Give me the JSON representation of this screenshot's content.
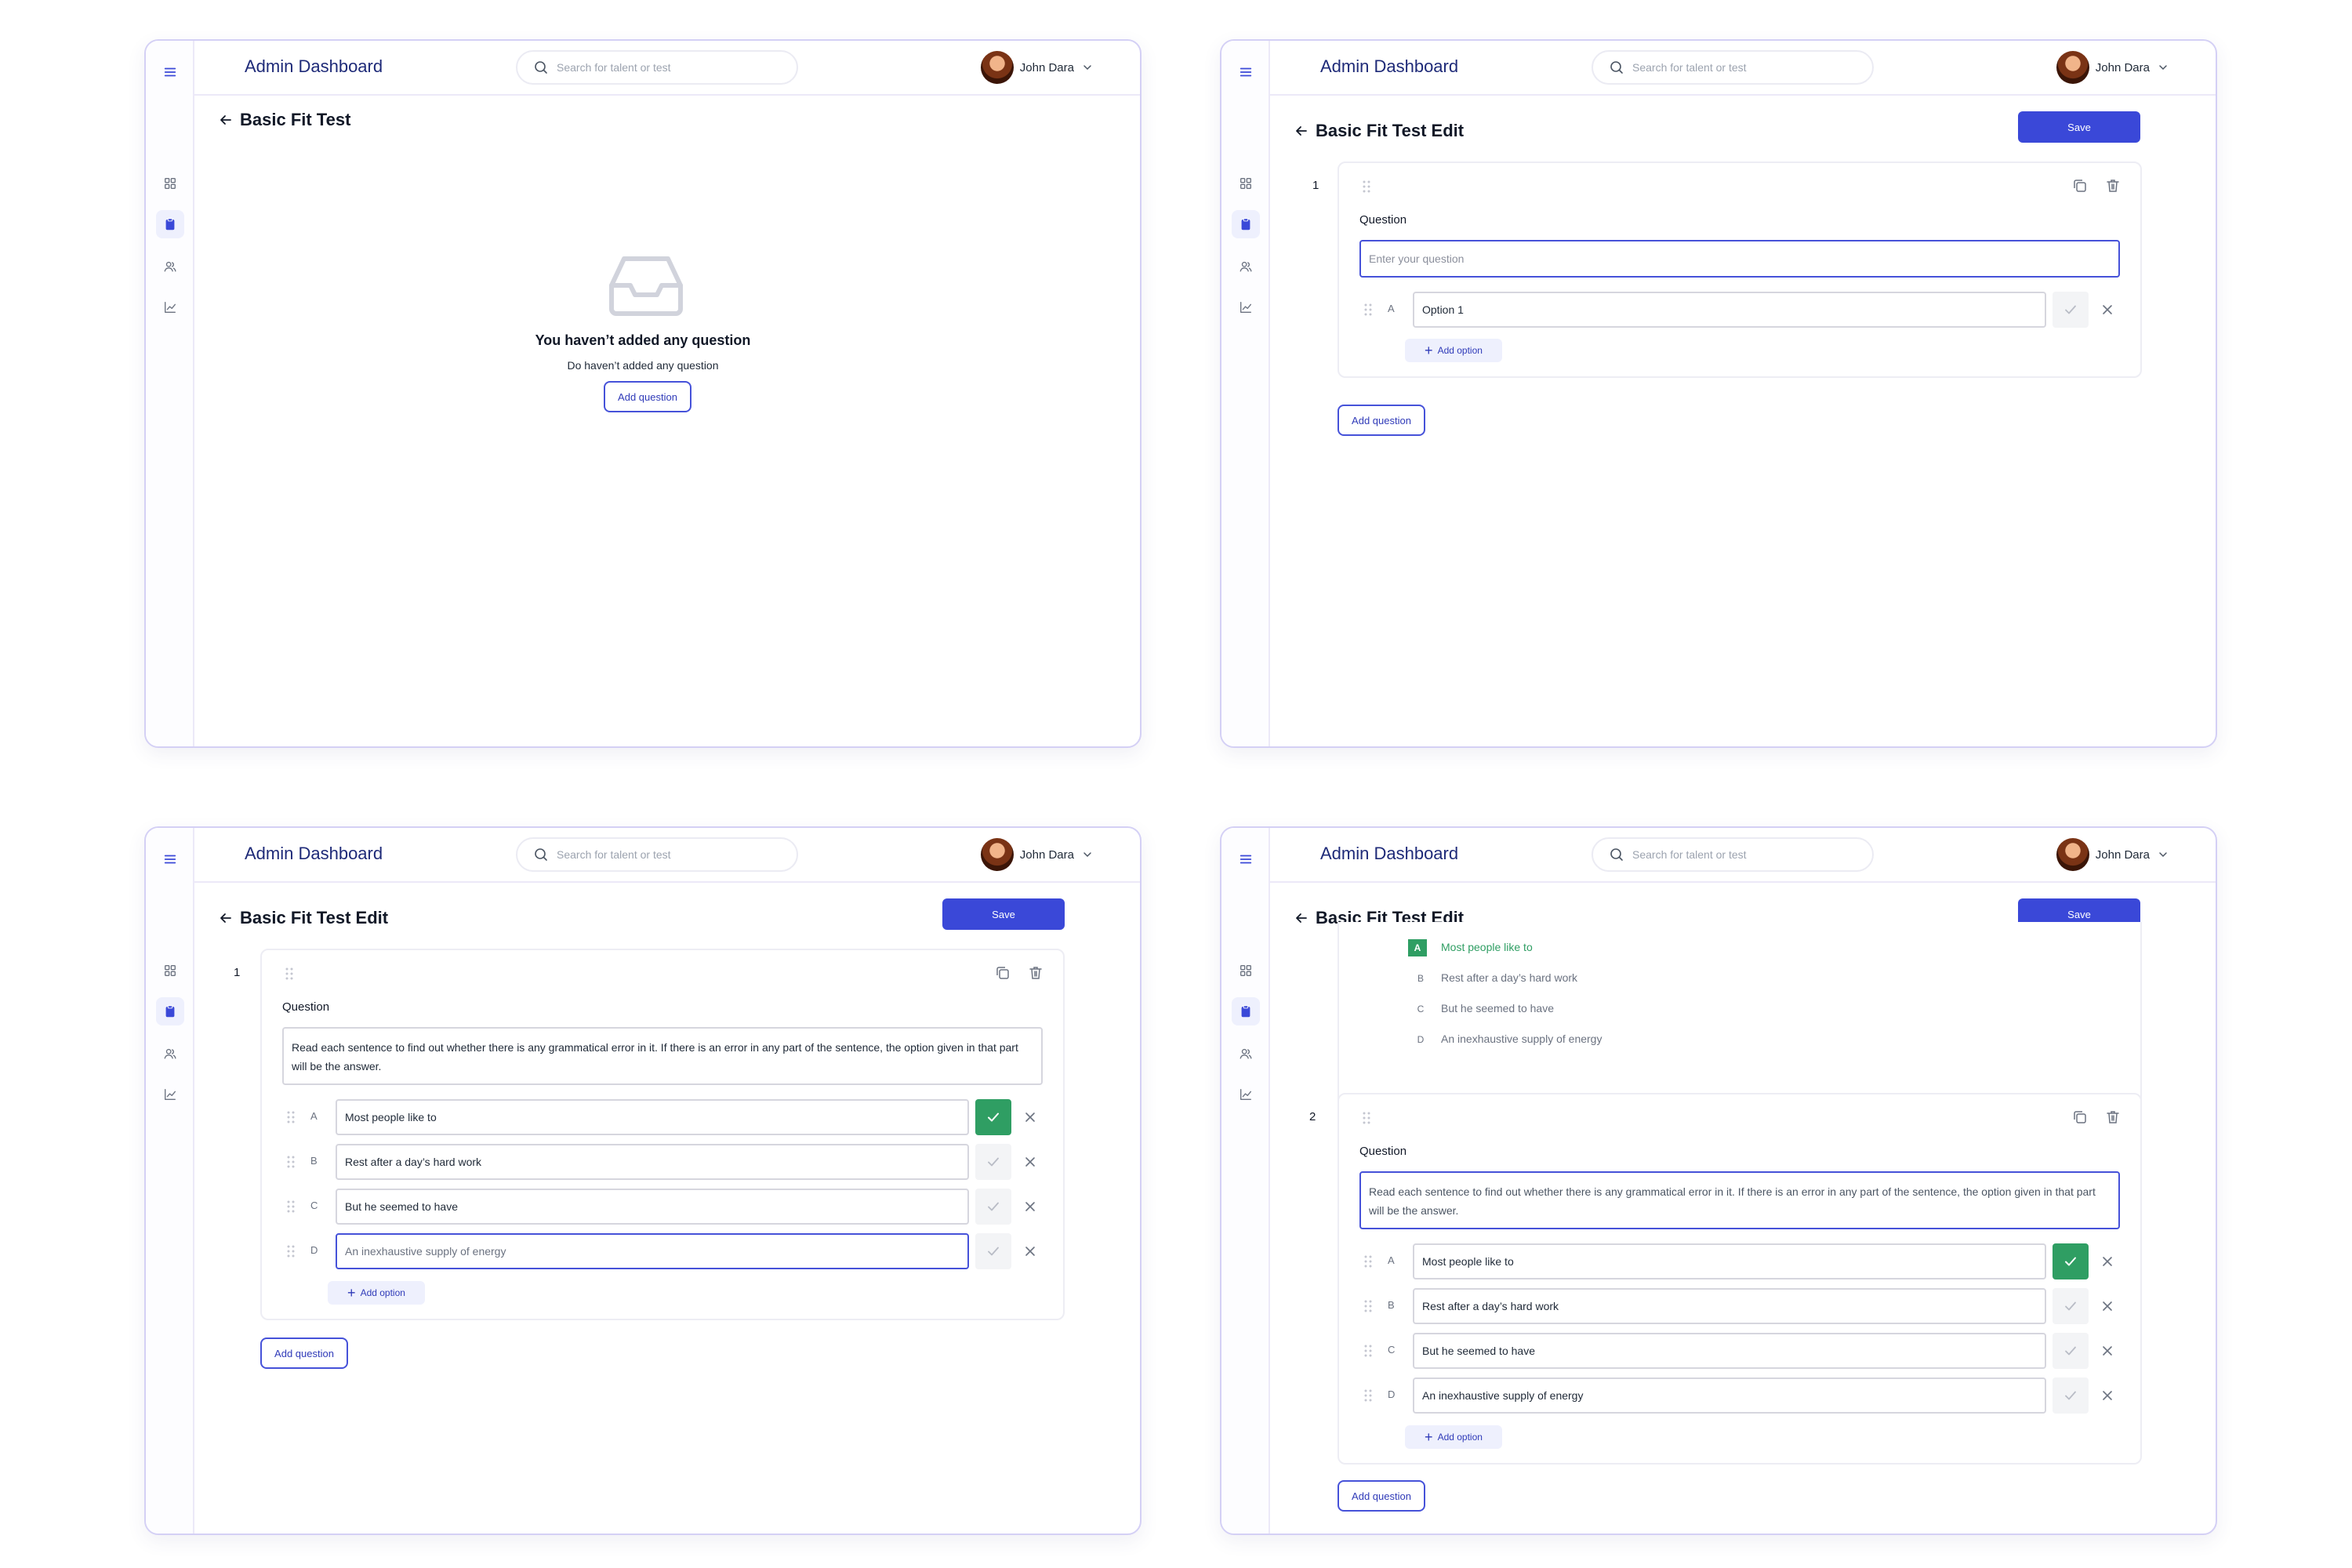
{
  "header": {
    "app_title": "Admin Dashboard",
    "search_placeholder": "Search for talent or test",
    "user_name": "John Dara"
  },
  "sidebar": {
    "items": [
      {
        "icon": "grid-icon"
      },
      {
        "icon": "clipboard-icon",
        "active": true
      },
      {
        "icon": "users-icon"
      },
      {
        "icon": "chart-line-icon"
      }
    ]
  },
  "screen1": {
    "title": "Basic Fit Test",
    "empty_title": "You haven’t added any question",
    "empty_subtitle": "Do haven’t added any question",
    "add_question": "Add question"
  },
  "screen2": {
    "title": "Basic Fit Test Edit",
    "save": "Save",
    "question_number": "1",
    "question_label": "Question",
    "question_placeholder": "Enter your question",
    "options": [
      {
        "letter": "A",
        "value": "Option 1"
      }
    ],
    "add_option": "Add option",
    "add_question": "Add question"
  },
  "screen3": {
    "title": "Basic Fit Test Edit",
    "save": "Save",
    "question_number": "1",
    "question_label": "Question",
    "question_value": "Read each sentence to find out whether there is any grammatical error in it. If there is an error in any part of the sentence, the option given in that part will be the answer.",
    "options": [
      {
        "letter": "A",
        "value": "Most people like to",
        "correct": true
      },
      {
        "letter": "B",
        "value": "Rest after a day’s hard work",
        "correct": false
      },
      {
        "letter": "C",
        "value": "But he seemed to have",
        "correct": false
      },
      {
        "letter": "D",
        "value": "An inexhaustive supply of energy",
        "correct": false
      }
    ],
    "add_option": "Add option",
    "add_question": "Add question"
  },
  "screen4": {
    "title": "Basic Fit Test Edit",
    "save": "Save",
    "preview_options": [
      {
        "letter": "A",
        "value": "Most people like to",
        "correct": true
      },
      {
        "letter": "B",
        "value": "Rest after a day’s hard work",
        "correct": false
      },
      {
        "letter": "C",
        "value": "But he seemed to have",
        "correct": false
      },
      {
        "letter": "D",
        "value": "An inexhaustive supply of energy",
        "correct": false
      }
    ],
    "question_number": "2",
    "question_label": "Question",
    "question_value": "Read each sentence to find out whether there is any grammatical error in it. If there is an error in any part of the sentence, the option given in that part will be the answer.",
    "options": [
      {
        "letter": "A",
        "value": "Most people like to",
        "correct": true
      },
      {
        "letter": "B",
        "value": "Rest after a day’s hard work",
        "correct": false
      },
      {
        "letter": "C",
        "value": "But he seemed to have",
        "correct": false
      },
      {
        "letter": "D",
        "value": "An inexhaustive supply of energy",
        "correct": false
      }
    ],
    "add_option": "Add option",
    "add_question": "Add question"
  },
  "colors": {
    "accent": "#3a48d8",
    "success": "#2f9e63",
    "frame_border": "#d4d0f5",
    "title": "#1e2a78"
  }
}
